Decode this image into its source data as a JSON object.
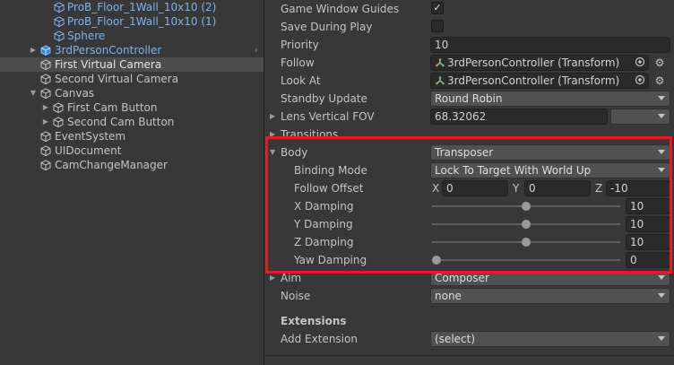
{
  "hierarchy": {
    "items": [
      {
        "label": "ProB_Floor_1Wall_10x10 (2)",
        "blue": true
      },
      {
        "label": "ProB_Floor_1Wall_10x10 (1)",
        "blue": true
      },
      {
        "label": "Sphere",
        "blue": true
      },
      {
        "label": "3rdPersonController",
        "blue": true
      },
      {
        "label": "First Virtual Camera",
        "blue": false
      },
      {
        "label": "Second Virtual Camera",
        "blue": false
      },
      {
        "label": "Canvas",
        "blue": false
      },
      {
        "label": "First Cam Button",
        "blue": false
      },
      {
        "label": "Second Cam Button",
        "blue": false
      },
      {
        "label": "EventSystem",
        "blue": false
      },
      {
        "label": "UIDocument",
        "blue": false
      },
      {
        "label": "CamChangeManager",
        "blue": false
      }
    ]
  },
  "inspector": {
    "game_window_guides": {
      "label": "Game Window Guides",
      "checked": true,
      "check_glyph": "✓"
    },
    "save_during_play": {
      "label": "Save During Play",
      "checked": false
    },
    "priority": {
      "label": "Priority",
      "value": "10"
    },
    "follow": {
      "label": "Follow",
      "value": "3rdPersonController (Transform)"
    },
    "look_at": {
      "label": "Look At",
      "value": "3rdPersonController (Transform)"
    },
    "standby_update": {
      "label": "Standby Update",
      "value": "Round Robin"
    },
    "lens_vertical_fov": {
      "label": "Lens Vertical FOV",
      "value": "68.32062"
    },
    "transitions": {
      "label": "Transitions"
    },
    "body": {
      "label": "Body",
      "value": "Transposer",
      "binding_mode": {
        "label": "Binding Mode",
        "value": "Lock To Target With World Up"
      },
      "follow_offset": {
        "label": "Follow Offset",
        "x_label": "X",
        "x": "0",
        "y_label": "Y",
        "y": "0",
        "z_label": "Z",
        "z": "-10"
      },
      "x_damping": {
        "label": "X Damping",
        "value": "10",
        "fraction": 0.5
      },
      "y_damping": {
        "label": "Y Damping",
        "value": "10",
        "fraction": 0.5
      },
      "z_damping": {
        "label": "Z Damping",
        "value": "10",
        "fraction": 0.5
      },
      "yaw_damping": {
        "label": "Yaw Damping",
        "value": "0",
        "fraction": 0
      }
    },
    "aim": {
      "label": "Aim",
      "value": "Composer"
    },
    "noise": {
      "label": "Noise",
      "value": "none"
    },
    "extensions": {
      "header": "Extensions",
      "add_label": "Add Extension",
      "add_value": "(select)"
    }
  },
  "colors": {
    "highlight": "#e21d1d",
    "prefab_blue": "#7bb3f2",
    "selection": "#4d4d4d"
  }
}
